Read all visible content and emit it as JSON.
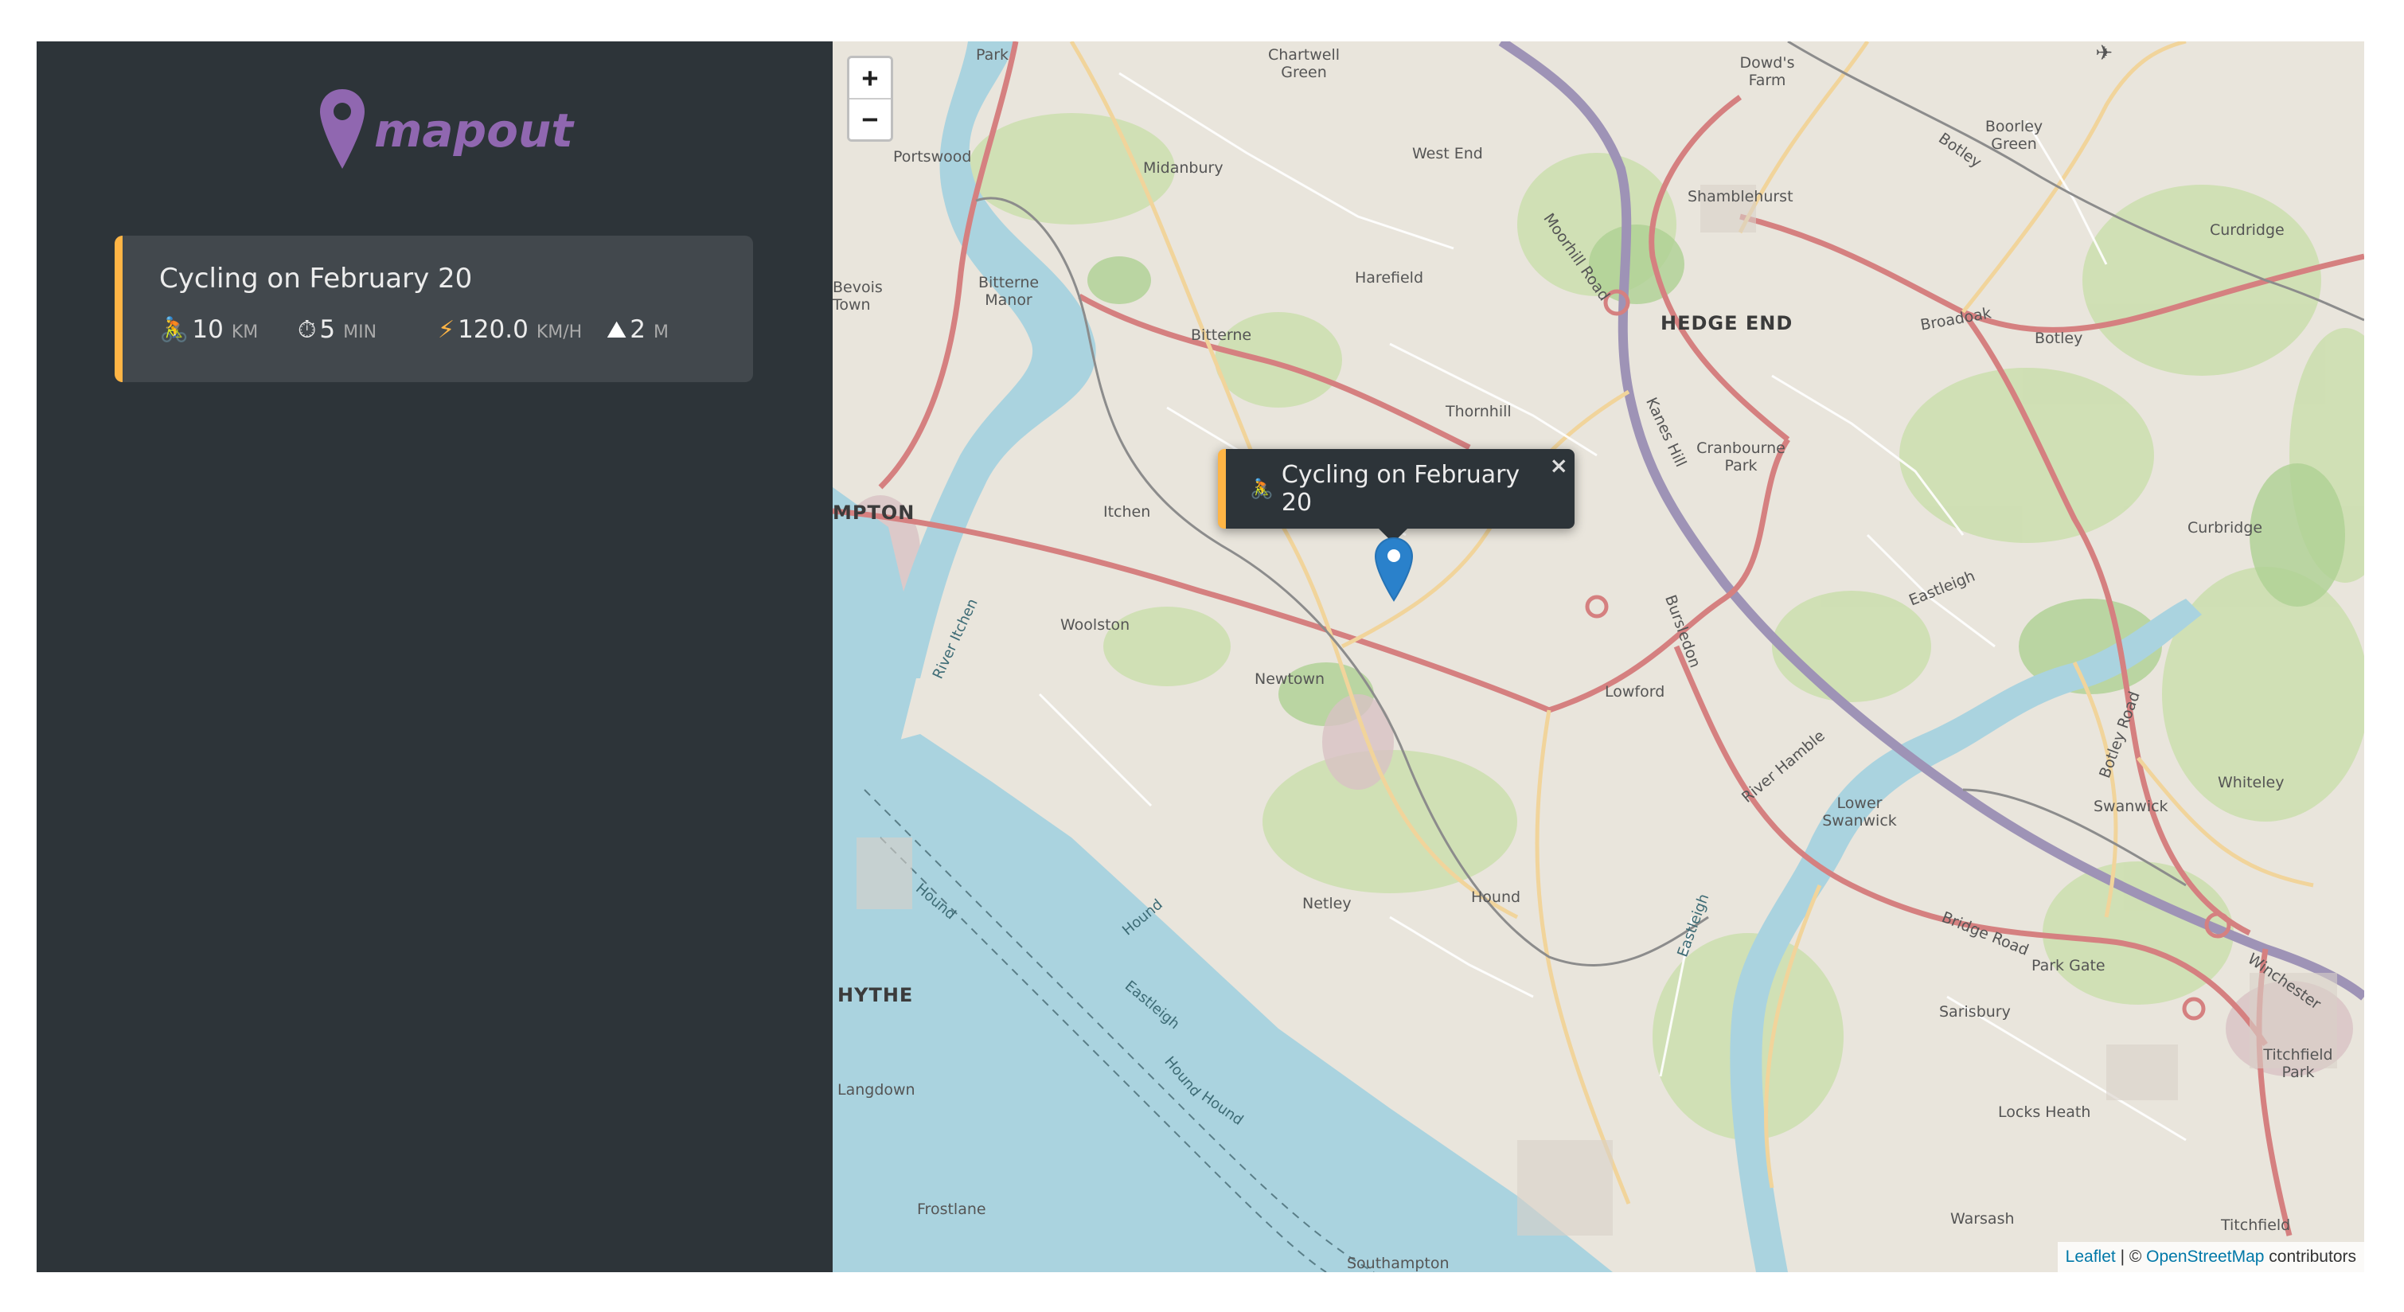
{
  "brand": {
    "name": "mapout",
    "logo_icon": "map-pin-icon",
    "color": "#9067b0"
  },
  "sidebar": {
    "background": "#2d3439",
    "workouts": [
      {
        "type": "cycling",
        "accent": "#ffb545",
        "title": "Cycling on February 20",
        "icon_activity": "cyclist-icon",
        "distance": {
          "icon": "🚴",
          "value": "10",
          "unit": "km"
        },
        "duration": {
          "icon": "⏱",
          "value": "5",
          "unit": "min"
        },
        "speed": {
          "icon": "⚡",
          "value": "120.0",
          "unit": "km/h"
        },
        "elevation": {
          "icon": "⛰",
          "value": "2",
          "unit": "m"
        }
      }
    ]
  },
  "map": {
    "zoom_in": "+",
    "zoom_out": "−",
    "popup": {
      "icon": "🚴",
      "text": "Cycling on February 20",
      "close": "×"
    },
    "labels": {
      "hedge_end": "HEDGE END",
      "southampton": "MPTON",
      "hythe": "HYTHE",
      "park": "Park",
      "chartwell": "Chartwell Green",
      "portswood": "Portswood",
      "midanbury": "Midanbury",
      "west_end": "West End",
      "dowds_farm": "Dowd's Farm",
      "shamblehurst": "Shamblehurst",
      "boorley_green": "Boorley Green",
      "botley": "Botley",
      "curdridge": "Curdridge",
      "broadoak": "Broadoak",
      "harefield": "Harefield",
      "bitterne_manor": "Bitterne Manor",
      "bevois_town": "Bevois Town",
      "bitterne": "Bitterne",
      "thornhill": "Thornhill",
      "cranbourne_park": "Cranbourne Park",
      "itchen": "Itchen",
      "woolston": "Woolston",
      "newtown": "Newtown",
      "lowford": "Lowford",
      "eastleigh": "Eastleigh",
      "curbridge": "Curbridge",
      "whiteley": "Whiteley",
      "swanwick": "Swanwick",
      "lower_swanwick": "Lower Swanwick",
      "netley": "Netley",
      "hound": "Hound",
      "park_gate": "Park Gate",
      "sarisbury": "Sarisbury",
      "titchfield_park": "Titchfield Park",
      "locks_heath": "Locks Heath",
      "warsash": "Warsash",
      "titchfield": "Titchfield",
      "langdown": "Langdown",
      "frostlane": "Frostlane",
      "southampton_water": "Southampton",
      "moorhill_road": "Moorhill Road",
      "kanes_hill": "Kanes Hill",
      "bursledon": "Bursledon",
      "bridge_road": "Bridge Road",
      "botley_road": "Botley Road",
      "winchester": "Winchester",
      "river_itchen": "River Itchen",
      "river_hamble": "River Hamble"
    },
    "attribution": {
      "leaflet": "Leaflet",
      "separator": " | © ",
      "osm": "OpenStreetMap",
      "suffix": " contributors"
    }
  }
}
